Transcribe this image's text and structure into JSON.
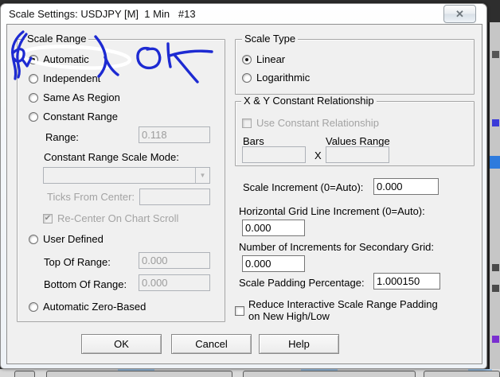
{
  "window": {
    "title": "Scale Settings: USDJPY [M]  1 Min   #13",
    "close_glyph": "✕"
  },
  "scale_range": {
    "title": "Scale Range",
    "automatic": "Automatic",
    "independent": "Independent",
    "same_as_region": "Same As Region",
    "constant_range": "Constant Range",
    "range_label": "Range:",
    "range_value": "0.118",
    "mode_label": "Constant Range Scale Mode:",
    "ticks_label": "Ticks From Center:",
    "ticks_value": "",
    "recenter_label": "Re-Center On Chart Scroll",
    "user_defined": "User Defined",
    "top_label": "Top Of Range:",
    "top_value": "0.000",
    "bottom_label": "Bottom Of Range:",
    "bottom_value": "0.000",
    "auto_zero": "Automatic Zero-Based",
    "selected_option": "Automatic"
  },
  "scale_type": {
    "title": "Scale Type",
    "linear": "Linear",
    "logarithmic": "Logarithmic",
    "selected_option": "Linear"
  },
  "xy_relationship": {
    "title": "X & Y Constant Relationship",
    "use_label": "Use Constant Relationship",
    "bars_label": "Bars",
    "values_label": "Values Range",
    "multiply_label": "X",
    "bars_value": "",
    "values_value": ""
  },
  "increments": {
    "scale_increment_label": "Scale Increment (0=Auto):",
    "scale_increment_value": "0.000",
    "hgrid_label": "Horizontal Grid Line Increment (0=Auto):",
    "hgrid_value": "0.000",
    "secondary_label": "Number of Increments for Secondary Grid:",
    "secondary_value": "0.000",
    "padding_label": "Scale Padding Percentage:",
    "padding_value": "1.000150",
    "reduce_label_line1": "Reduce Interactive Scale Range Padding",
    "reduce_label_line2": "on New High/Low"
  },
  "buttons": {
    "ok": "OK",
    "cancel": "Cancel",
    "help": "Help"
  },
  "icons": {
    "dropdown_glyph": "▼",
    "check_glyph": "✔"
  },
  "annotation": {
    "drawn_text": "OK",
    "pen_color": "#1d2ad2",
    "highlight_color": "#ffffff"
  }
}
